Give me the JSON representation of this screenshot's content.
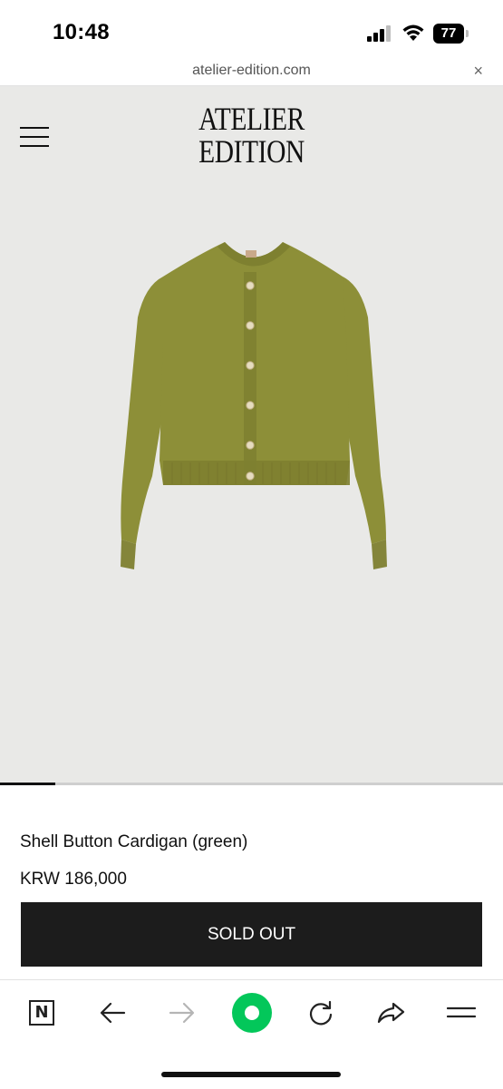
{
  "status_bar": {
    "time": "10:48",
    "battery": "77"
  },
  "browser": {
    "url": "atelier-edition.com",
    "close_label": "×"
  },
  "brand": {
    "line1": "ATELIER",
    "line2": "EDITION"
  },
  "product": {
    "name": "Shell Button Cardigan (green)",
    "price": "KRW 186,000",
    "cta_label": "SOLD OUT",
    "garment_color": "#8d8f38",
    "image_progress": 0.11
  },
  "toolbar": {
    "items": [
      "n-app-icon",
      "back-arrow-icon",
      "forward-arrow-icon",
      "green-dot-button",
      "refresh-icon",
      "share-icon",
      "menu-icon"
    ]
  }
}
